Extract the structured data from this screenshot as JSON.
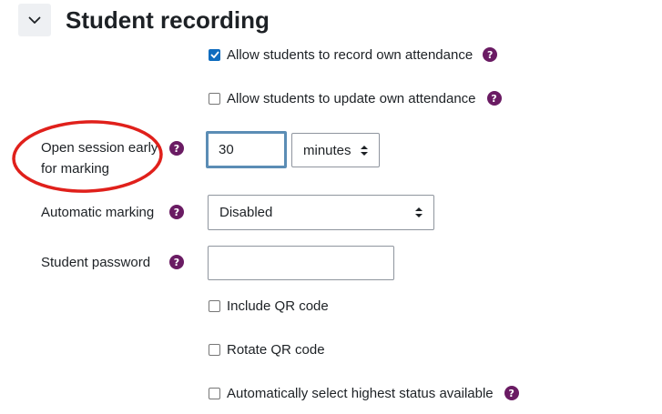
{
  "section": {
    "title": "Student recording",
    "collapse_icon": "chevron-down-icon"
  },
  "checkboxes": {
    "record_own": {
      "label": "Allow students to record own attendance",
      "checked": true
    },
    "update_own": {
      "label": "Allow students to update own attendance",
      "checked": false
    },
    "include_qr": {
      "label": "Include QR code",
      "checked": false
    },
    "rotate_qr": {
      "label": "Rotate QR code",
      "checked": false
    },
    "auto_highest": {
      "label": "Automatically select highest status available",
      "checked": false
    }
  },
  "open_early": {
    "label_line1": "Open session early",
    "label_line2": "for marking",
    "value": "30",
    "unit": "minutes"
  },
  "automatic_marking": {
    "label": "Automatic marking",
    "value": "Disabled"
  },
  "student_password": {
    "label": "Student password",
    "value": ""
  },
  "help_glyph": "?",
  "colors": {
    "help_icon": "#6a1b63",
    "checkbox_checked": "#0f6cbf",
    "focus_border": "#5b8db5",
    "annotation_circle": "#e0201b"
  }
}
